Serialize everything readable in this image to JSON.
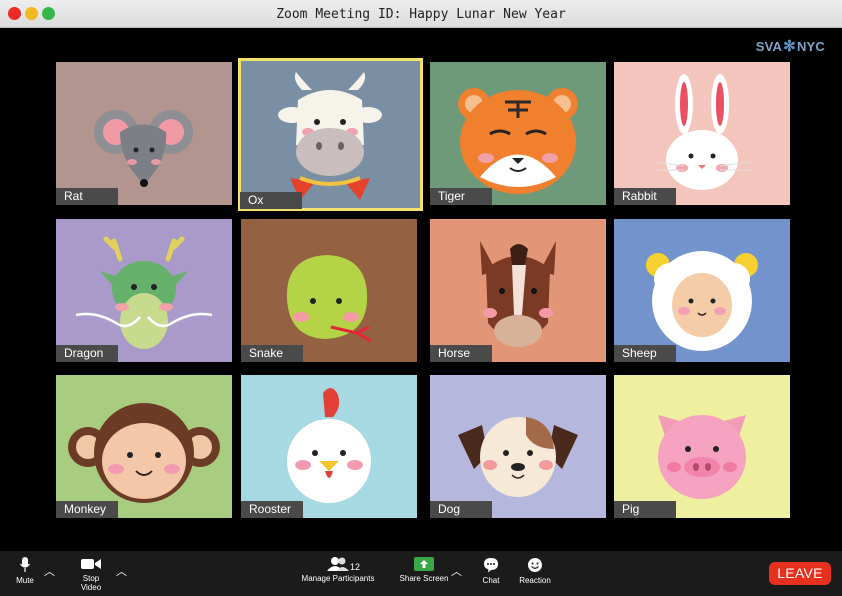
{
  "window": {
    "title": "Zoom Meeting ID: Happy Lunar New Year",
    "brand_left": "SVA",
    "brand_right": "NYC"
  },
  "participants": [
    {
      "name": "Rat",
      "bg": "#b3958f",
      "icon": "rat-face-icon"
    },
    {
      "name": "Ox",
      "bg": "#7a8fa3",
      "icon": "ox-face-icon",
      "active": true
    },
    {
      "name": "Tiger",
      "bg": "#6e9a7a",
      "icon": "tiger-face-icon"
    },
    {
      "name": "Rabbit",
      "bg": "#f4c5bd",
      "icon": "rabbit-face-icon"
    },
    {
      "name": "Dragon",
      "bg": "#a99ac9",
      "icon": "dragon-face-icon"
    },
    {
      "name": "Snake",
      "bg": "#946240",
      "icon": "snake-face-icon"
    },
    {
      "name": "Horse",
      "bg": "#e39677",
      "icon": "horse-face-icon"
    },
    {
      "name": "Sheep",
      "bg": "#7293cb",
      "icon": "sheep-face-icon"
    },
    {
      "name": "Monkey",
      "bg": "#a9cd80",
      "icon": "monkey-face-icon"
    },
    {
      "name": "Rooster",
      "bg": "#a6d9e2",
      "icon": "rooster-face-icon"
    },
    {
      "name": "Dog",
      "bg": "#b5b7dd",
      "icon": "dog-face-icon"
    },
    {
      "name": "Pig",
      "bg": "#eef0a0",
      "icon": "pig-face-icon"
    }
  ],
  "toolbar": {
    "mute_label": "Mute",
    "stop_video_label": "Stop Video",
    "participants_label": "Manage Participants",
    "participants_count": "12",
    "share_label": "Share Screen",
    "chat_label": "Chat",
    "reaction_label": "Reaction",
    "leave_label": "LEAVE",
    "accent_green": "#3aa64a",
    "leave_color": "#e8301f"
  }
}
